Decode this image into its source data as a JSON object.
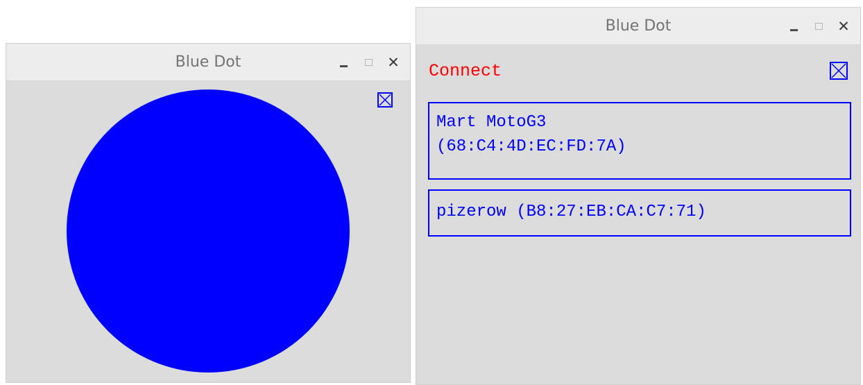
{
  "windows": {
    "dot": {
      "title": "Blue Dot",
      "controls": {
        "minimize": "minimize",
        "maximize": "maximize",
        "close": "✕"
      },
      "fullscreen_icon": "fullscreen-toggle-icon",
      "dot_color": "#0000ff"
    },
    "connect": {
      "title": "Blue Dot",
      "controls": {
        "minimize": "minimize",
        "maximize": "maximize",
        "close": "✕"
      },
      "connect_label": "Connect",
      "connect_color": "#ff0000",
      "fullscreen_icon": "fullscreen-toggle-icon",
      "devices": [
        {
          "name": "Mart MotoG3",
          "address": "(68:C4:4D:EC:FD:7A)"
        },
        {
          "label": "pizerow (B8:27:EB:CA:C7:71)"
        }
      ],
      "device_color": "#0000ff"
    }
  },
  "colors": {
    "background": "#dcdcdc",
    "titlebar": "#ededed",
    "title_text": "#747474"
  }
}
